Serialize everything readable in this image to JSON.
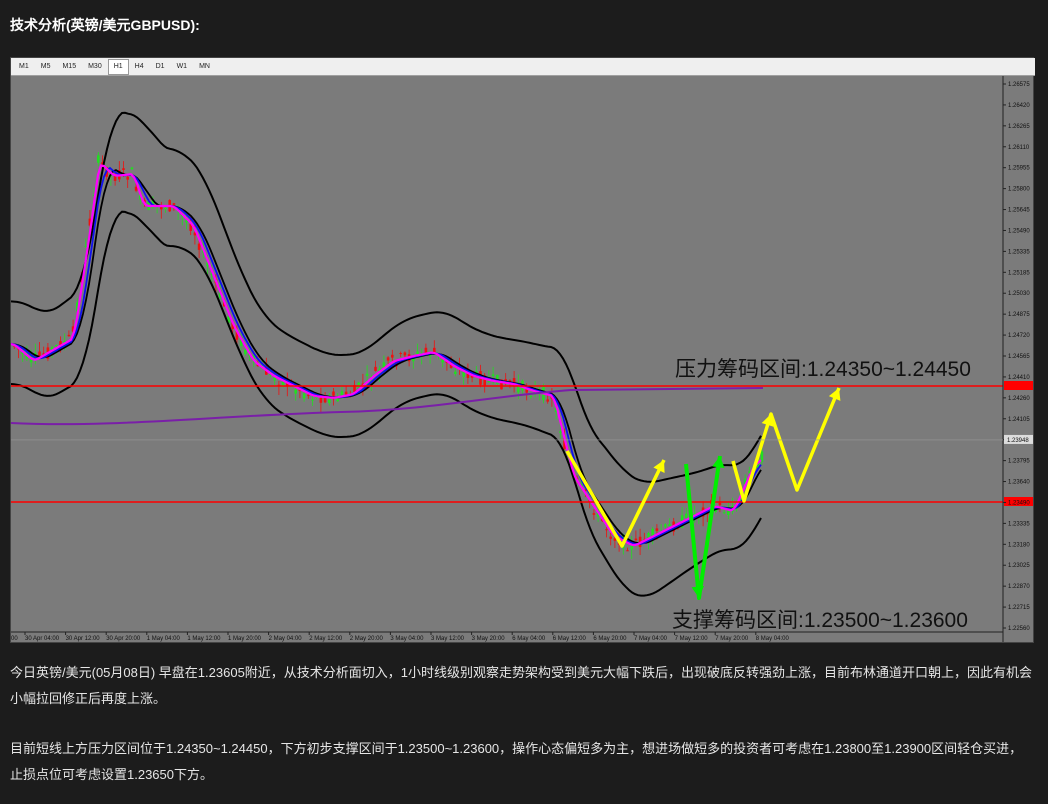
{
  "heading": "技术分析(英镑/美元GBPUSD):",
  "toolbar": {
    "timeframes": [
      "M1",
      "M5",
      "M15",
      "M30",
      "H1",
      "H4",
      "D1",
      "W1",
      "MN"
    ],
    "active": "H1"
  },
  "y_axis": {
    "labels": [
      "1.26575",
      "1.26420",
      "1.26265",
      "1.26110",
      "1.25955",
      "1.25800",
      "1.25645",
      "1.25490",
      "1.25335",
      "1.25185",
      "1.25030",
      "1.24875",
      "1.24720",
      "1.24565",
      "1.24410",
      "1.24260",
      "1.24105",
      "1.23948",
      "1.23795",
      "1.23640",
      "1.23490",
      "1.23335",
      "1.23180",
      "1.23025",
      "1.22870",
      "1.22715",
      "1.22560"
    ],
    "current_price": "1.23948"
  },
  "x_axis": {
    "labels": [
      "30 Apr 04:00",
      "30 Apr 12:00",
      "30 Apr 20:00",
      "1 May 04:00",
      "1 May 12:00",
      "1 May 20:00",
      "2 May 04:00",
      "2 May 12:00",
      "2 May 20:00",
      "3 May 04:00",
      "3 May 12:00",
      "3 May 20:00",
      "6 May 04:00",
      "6 May 12:00",
      "6 May 20:00",
      "7 May 04:00",
      "7 May 12:00",
      "7 May 20:00",
      "8 May 04:00"
    ]
  },
  "annotations": {
    "resistance": "压力筹码区间:1.24350~1.24450",
    "support": "支撑筹码区间:1.23500~1.23600"
  },
  "colors": {
    "bull": "#22dd22",
    "bear": "#ee1111",
    "ma_fast": "#ff00ff",
    "ma_mid": "#1010ee",
    "bands": "#000000",
    "ma_long": "#7a1fa8",
    "level_lines": "#ff0000",
    "arrow_yellow": "#ffff00",
    "arrow_green": "#00ee00"
  },
  "paragraphs": [
    "今日英镑/美元(05月08日) 早盘在1.23605附近，从技术分析面切入，1小时线级别观察走势架构受到美元大幅下跌后，出现破底反转强劲上涨，目前布林通道开口朝上，因此有机会小幅拉回修正后再度上涨。",
    "目前短线上方压力区间位于1.24350~1.24450，下方初步支撑区间于1.23500~1.23600，操作心态偏短多为主，想进场做短多的投资者可考虑在1.23800至1.23900区间轻仓买进，止损点位可考虑设置1.23650下方。"
  ]
}
